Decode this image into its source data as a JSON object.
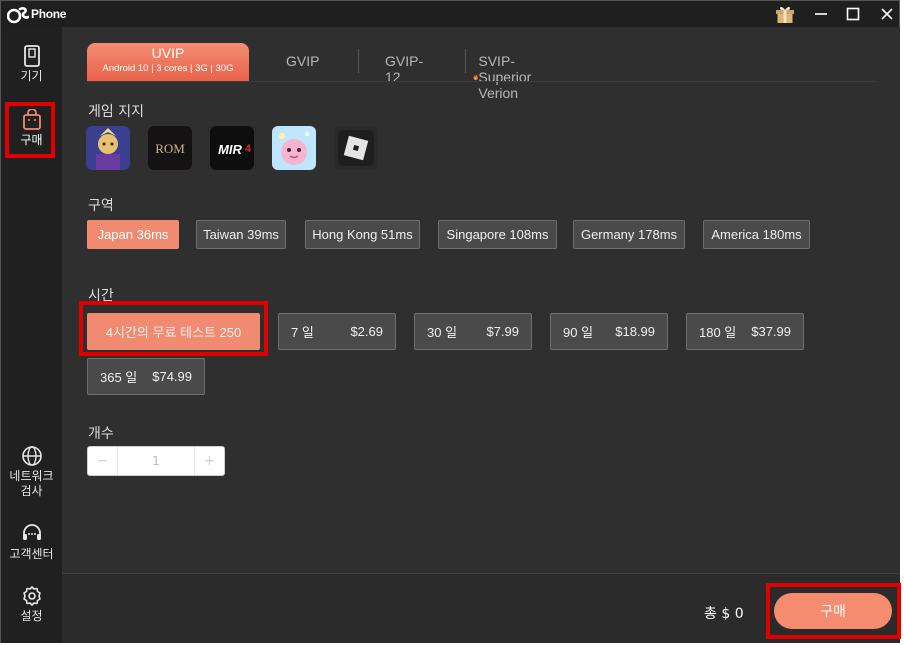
{
  "app": {
    "name": "Phone"
  },
  "sidebar": {
    "items": [
      {
        "label": "기기",
        "icon": "phone-icon"
      },
      {
        "label": "구매",
        "icon": "shopping-bag-icon",
        "active": true
      },
      {
        "label": "네트워크\n검사",
        "label_line1": "네트워크",
        "label_line2": "검사",
        "icon": "globe-icon"
      },
      {
        "label": "고객센터",
        "icon": "headset-icon"
      },
      {
        "label": "설정",
        "icon": "gear-icon"
      }
    ]
  },
  "tabs": {
    "active": {
      "title": "UVIP",
      "subtitle": "Android 10 | 3 cores | 3G | 30G"
    },
    "others": [
      "GVIP",
      "GVIP-12",
      "SVIP-Superior Verion"
    ]
  },
  "games": {
    "title": "게임 지지",
    "items": [
      "game-hero-icon",
      "rom-game-icon",
      "mir4-game-icon",
      "cute-game-icon",
      "roblox-game-icon"
    ]
  },
  "region": {
    "title": "구역",
    "options": [
      {
        "label": "Japan 36ms",
        "selected": true
      },
      {
        "label": "Taiwan 39ms"
      },
      {
        "label": "Hong Kong 51ms"
      },
      {
        "label": "Singapore 108ms"
      },
      {
        "label": "Germany 178ms"
      },
      {
        "label": "America 180ms"
      }
    ]
  },
  "time": {
    "title": "시간",
    "options": [
      {
        "label": "4시간의 무료 테스트 250",
        "price": "",
        "selected": true
      },
      {
        "label": "7 일",
        "price": "$2.69"
      },
      {
        "label": "30 일",
        "price": "$7.99"
      },
      {
        "label": "90 일",
        "price": "$18.99"
      },
      {
        "label": "180 일",
        "price": "$37.99"
      },
      {
        "label": "365 일",
        "price": "$74.99"
      }
    ]
  },
  "quantity": {
    "title": "개수",
    "value": "1",
    "minus": "−",
    "plus": "+"
  },
  "footer": {
    "total_label": "총 $ 0",
    "buy_label": "구매"
  },
  "colors": {
    "accent": "#f08a70",
    "highlight": "#e00000",
    "background": "#2f2f2f"
  }
}
